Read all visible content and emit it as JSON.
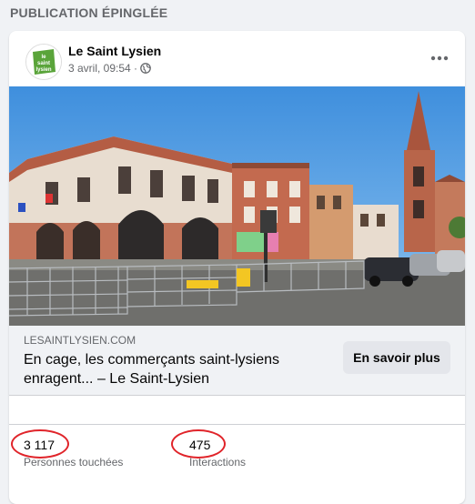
{
  "section_title": "PUBLICATION ÉPINGLÉE",
  "post": {
    "page_name": "Le Saint Lysien",
    "timestamp": "3 avril, 09:54 ·",
    "privacy_icon": "globe-icon",
    "more_icon": "more-horizontal-icon",
    "avatar_text": [
      "le",
      "saint",
      "lysien"
    ]
  },
  "link_preview": {
    "domain": "LESAINTLYSIEN.COM",
    "title": "En cage, les commerçants saint-lysiens enragent... – Le Saint-Lysien",
    "button_label": "En savoir plus"
  },
  "insights": {
    "reach_value": "3 117",
    "reach_label": "Personnes touchées",
    "interactions_value": "475",
    "interactions_label": "Interactions"
  },
  "colors": {
    "annotation_circle": "#e0242a",
    "brand_green": "#5aa43a",
    "sky": "#4f9be0",
    "brick": "#b8654a"
  }
}
